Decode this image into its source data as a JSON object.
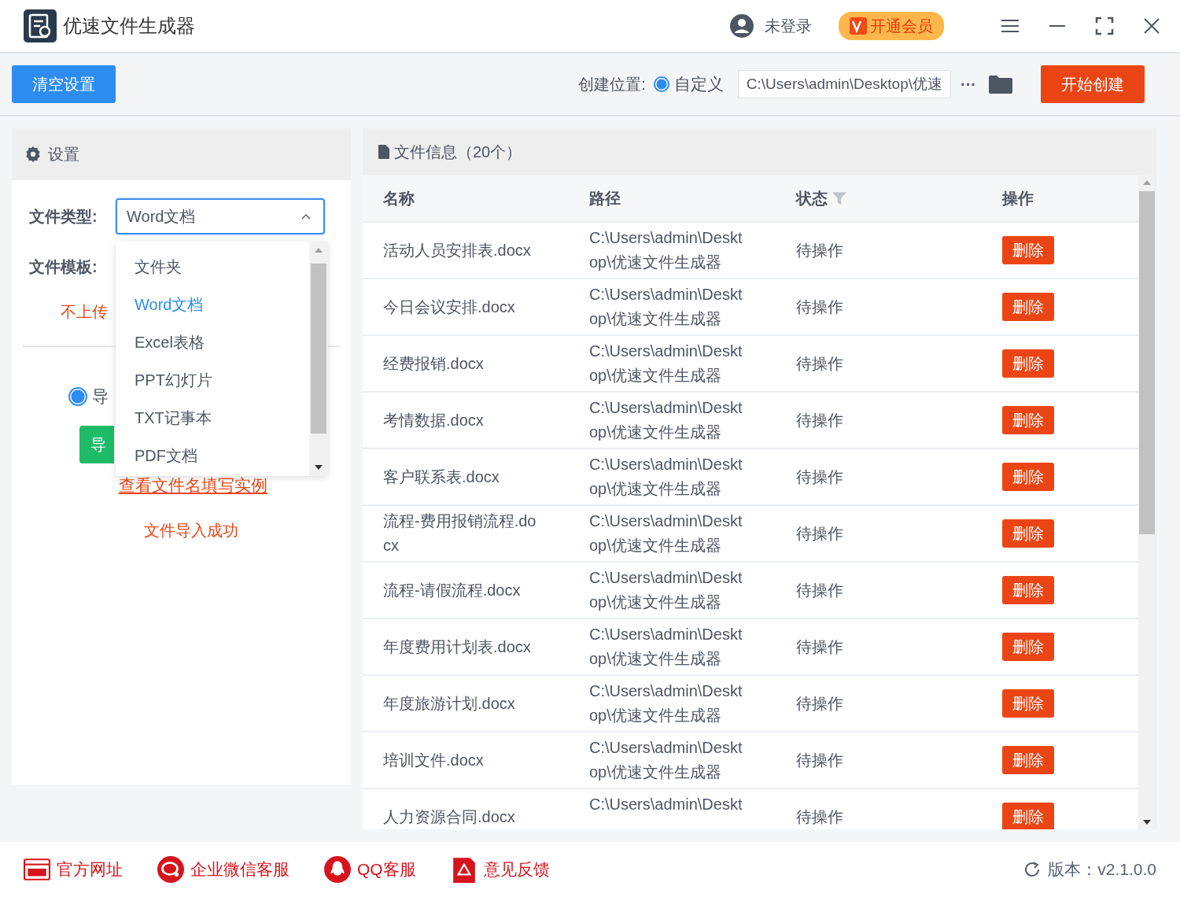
{
  "window": {
    "title": "优速文件生成器",
    "login": "未登录",
    "vip": "开通会员"
  },
  "toolbar": {
    "clear": "清空设置",
    "location_label": "创建位置:",
    "radio": {
      "label": "自定义",
      "selected": true
    },
    "path": "C:\\Users\\admin\\Desktop\\优速",
    "more": "···",
    "start": "开始创建"
  },
  "settings": {
    "title": "设置",
    "type_label": "文件类型:",
    "type_value": "Word文档",
    "expanded": true,
    "template_label": "文件模板:",
    "no_upload": "不上传",
    "import_radio": {
      "label": "导",
      "selected": true
    },
    "import_button": "导",
    "example_link": "查看文件名填写实例",
    "success": "文件导入成功",
    "options": [
      {
        "label": "文件夹",
        "selected": false
      },
      {
        "label": "Word文档",
        "selected": true
      },
      {
        "label": "Excel表格",
        "selected": false
      },
      {
        "label": "PPT幻灯片",
        "selected": false
      },
      {
        "label": "TXT记事本",
        "selected": false
      },
      {
        "label": "PDF文档",
        "selected": false
      }
    ]
  },
  "files": {
    "title": "文件信息（20个）",
    "columns": [
      "名称",
      "路径",
      "状态",
      "操作"
    ],
    "rows": [
      {
        "name": [
          "活动人员安排表.docx"
        ],
        "path": [
          "C:\\Users\\admin\\Deskt",
          "op\\优速文件生成器"
        ],
        "status": "待操作",
        "action": "删除"
      },
      {
        "name": [
          "今日会议安排.docx"
        ],
        "path": [
          "C:\\Users\\admin\\Deskt",
          "op\\优速文件生成器"
        ],
        "status": "待操作",
        "action": "删除"
      },
      {
        "name": [
          "经费报销.docx"
        ],
        "path": [
          "C:\\Users\\admin\\Deskt",
          "op\\优速文件生成器"
        ],
        "status": "待操作",
        "action": "删除"
      },
      {
        "name": [
          "考情数据.docx"
        ],
        "path": [
          "C:\\Users\\admin\\Deskt",
          "op\\优速文件生成器"
        ],
        "status": "待操作",
        "action": "删除"
      },
      {
        "name": [
          "客户联系表.docx"
        ],
        "path": [
          "C:\\Users\\admin\\Deskt",
          "op\\优速文件生成器"
        ],
        "status": "待操作",
        "action": "删除"
      },
      {
        "name": [
          "流程-费用报销流程.do",
          "cx"
        ],
        "path": [
          "C:\\Users\\admin\\Deskt",
          "op\\优速文件生成器"
        ],
        "status": "待操作",
        "action": "删除"
      },
      {
        "name": [
          "流程-请假流程.docx"
        ],
        "path": [
          "C:\\Users\\admin\\Deskt",
          "op\\优速文件生成器"
        ],
        "status": "待操作",
        "action": "删除"
      },
      {
        "name": [
          "年度费用计划表.docx"
        ],
        "path": [
          "C:\\Users\\admin\\Deskt",
          "op\\优速文件生成器"
        ],
        "status": "待操作",
        "action": "删除"
      },
      {
        "name": [
          "年度旅游计划.docx"
        ],
        "path": [
          "C:\\Users\\admin\\Deskt",
          "op\\优速文件生成器"
        ],
        "status": "待操作",
        "action": "删除"
      },
      {
        "name": [
          "培训文件.docx"
        ],
        "path": [
          "C:\\Users\\admin\\Deskt",
          "op\\优速文件生成器"
        ],
        "status": "待操作",
        "action": "删除"
      },
      {
        "name": [
          "人力资源合同.docx"
        ],
        "path": [
          "C:\\Users\\admin\\Deskt"
        ],
        "status": "待操作",
        "action": "删除"
      }
    ]
  },
  "footer": {
    "links": [
      {
        "kind": "web",
        "label": "官方网址"
      },
      {
        "kind": "wechat",
        "label": "企业微信客服"
      },
      {
        "kind": "qq",
        "label": "QQ客服"
      },
      {
        "kind": "feedback",
        "label": "意见反馈"
      }
    ],
    "version": "版本：v2.1.0.0"
  }
}
